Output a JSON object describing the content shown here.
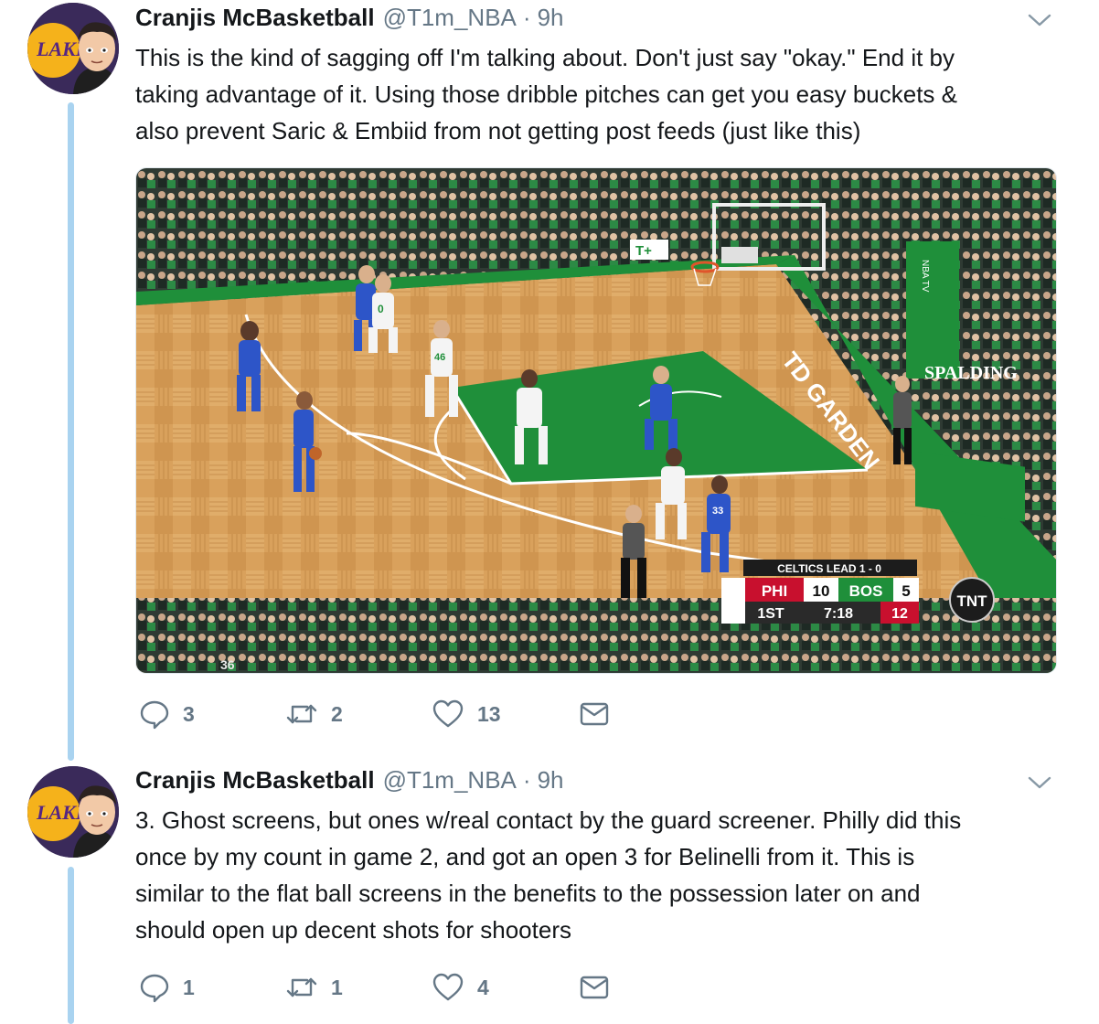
{
  "tweets": [
    {
      "author": "Cranjis McBasketball",
      "handle": "@T1m_NBA",
      "separator": "·",
      "time": "9h",
      "lines": [
        "This is the kind of sagging off I'm talking about. Don't just say \"okay.\" End it by",
        "taking advantage of it. Using those dribble pitches can get you easy buckets &",
        "also prevent Saric & Embiid from not getting post feeds (just like this)"
      ],
      "media": {
        "broadcast": {
          "series_banner": "CELTICS LEAD 1 - 0",
          "away_team": "PHI",
          "away_score": "10",
          "home_team": "BOS",
          "home_score": "5",
          "period": "1ST",
          "clock": "7:18",
          "shot_clock": "12",
          "network": "TNT"
        },
        "arena_signage": [
          "TD GARDEN",
          "SPALDING",
          "NBA TV",
          "T+"
        ],
        "jerseys": [
          "0",
          "46",
          "33",
          "36"
        ]
      },
      "stats": {
        "replies": "3",
        "retweets": "2",
        "likes": "13"
      }
    },
    {
      "author": "Cranjis McBasketball",
      "handle": "@T1m_NBA",
      "separator": "·",
      "time": "9h",
      "lines": [
        "3. Ghost screens, but ones w/real contact by the guard screener. Philly did this",
        "once by my count in game 2, and got an open 3 for Belinelli from it. This is",
        "similar to the flat ball screens in the benefits to the possession later on and",
        "should open up decent shots for shooters"
      ],
      "stats": {
        "replies": "1",
        "retweets": "1",
        "likes": "4"
      }
    }
  ],
  "icons": {
    "avatar": "lakers-cartoon-avatar",
    "reply": "reply-icon",
    "retweet": "retweet-icon",
    "like": "heart-icon",
    "message": "direct-message-icon",
    "menu": "chevron-down-icon"
  },
  "colors": {
    "text": "#14171a",
    "secondary": "#657786",
    "thread_line": "#a9d3f0",
    "court_green": "#1f8f3a",
    "sixers_blue": "#2d55c8",
    "lakers_gold": "#f5b21b",
    "lakers_purple": "#552583"
  }
}
